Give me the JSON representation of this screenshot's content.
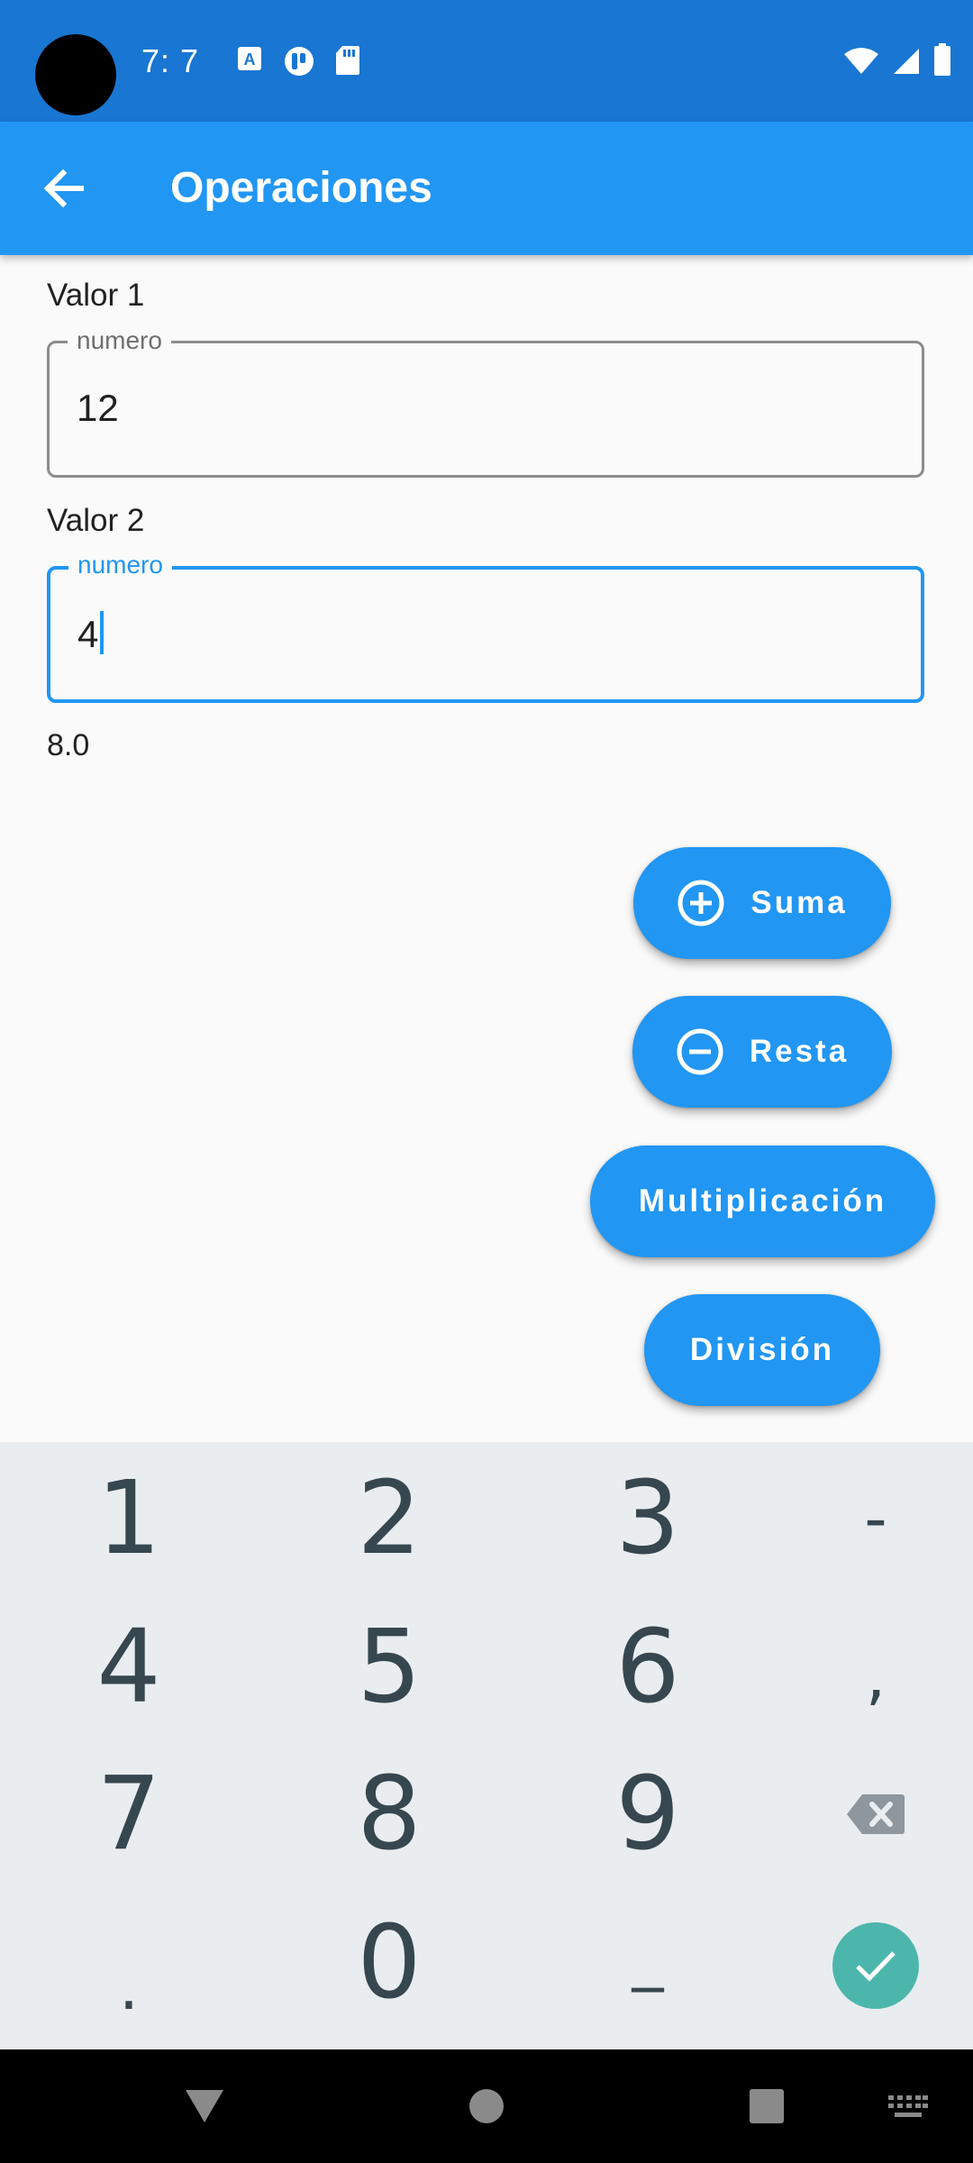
{
  "status_bar": {
    "time": "7: 7",
    "icons_left": [
      "a-font-icon",
      "trello-like-icon",
      "sd-card-icon"
    ],
    "icons_right": [
      "wifi-icon",
      "cell-signal-icon",
      "battery-icon"
    ]
  },
  "app_bar": {
    "title": "Operaciones",
    "back_icon": "arrow-back-icon",
    "color": "#2196f3"
  },
  "form": {
    "field1": {
      "label": "Valor 1",
      "legend": "numero",
      "value": "12"
    },
    "field2": {
      "label": "Valor 2",
      "legend": "numero",
      "value": "4"
    },
    "result": "8.0"
  },
  "buttons": {
    "suma": "Suma",
    "resta": "Resta",
    "multiplicacion": "Multiplicación",
    "division": "División"
  },
  "keyboard": {
    "row1": [
      "1",
      "2",
      "3",
      "-"
    ],
    "row2": [
      "4",
      "5",
      "6",
      ","
    ],
    "row3": [
      "7",
      "8",
      "9",
      "backspace"
    ],
    "row4": [
      ".",
      "0",
      "_",
      "enter"
    ],
    "enter_color": "#4db6ac"
  },
  "nav_bar": {
    "icons": [
      "back-triangle-icon",
      "home-circle-icon",
      "recents-square-icon",
      "keyboard-switch-icon"
    ]
  }
}
